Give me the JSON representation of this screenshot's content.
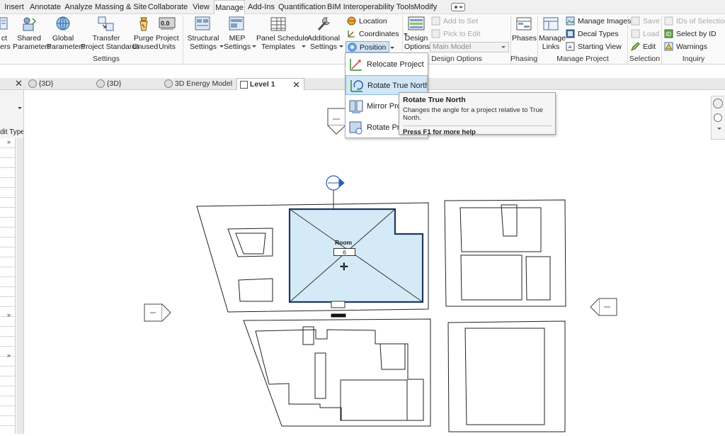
{
  "menu_tabs": [
    "Insert",
    "Annotate",
    "Analyze",
    "Massing & Site",
    "Collaborate",
    "View",
    "Manage",
    "Add-Ins",
    "Quantification",
    "BIM Interoperability Tools",
    "Modify"
  ],
  "active_menu_tab": "Manage",
  "ribbon": {
    "settings": {
      "cut_label_1": "ct",
      "cut_label_2": "ters",
      "shared_parameters_1": "Shared",
      "shared_parameters_2": "Parameters",
      "global_parameters_1": "Global",
      "global_parameters_2": "Parameters",
      "transfer_1": "Transfer",
      "transfer_2": "Project Standards",
      "purge_1": "Purge",
      "purge_2": "Unused",
      "project_units_1": "Project",
      "project_units_2": "Units",
      "units_icon_text": "0.0",
      "structural_1": "Structural",
      "structural_2": "Settings",
      "mep_1": "MEP",
      "mep_2": "Settings",
      "panel_schedule_1": "Panel Schedule",
      "panel_schedule_2": "Templates",
      "additional_1": "Additional",
      "additional_2": "Settings",
      "panel_label": "Settings"
    },
    "location": {
      "location": "Location",
      "coordinates": "Coordinates",
      "position": "Position"
    },
    "design_options": {
      "add_to_set": "Add to Set",
      "pick_to_edit": "Pick to Edit",
      "main_model": "Main Model",
      "design_options_1": "Design",
      "design_options_2": "Options",
      "panel_label": "Design Options"
    },
    "phasing": {
      "phases": "Phases",
      "panel_label": "Phasing"
    },
    "manage_project": {
      "manage_links_1": "Manage",
      "manage_links_2": "Links",
      "manage_images": "Manage  Images",
      "decal_types": "Decal  Types",
      "starting_view": "Starting  View",
      "panel_label": "Manage Project"
    },
    "selection": {
      "save": "Save",
      "load": "Load",
      "edit": "Edit",
      "panel_label": "Selection"
    },
    "inquiry": {
      "ids_of_selection": "IDs of  Selection",
      "select_by_id": "Select  by ID",
      "warnings": "Warnings",
      "panel_label": "Inquiry"
    }
  },
  "position_menu": {
    "items": [
      "Relocate Project",
      "Rotate True North",
      "Mirror Project",
      "Rotate Project"
    ],
    "highlighted": "Rotate True North"
  },
  "tooltip": {
    "title": "Rotate True North",
    "description": "Changes the angle for a project relative to True North.",
    "help": "Press F1 for more help"
  },
  "view_tabs": [
    {
      "label": "{3D}",
      "active": false
    },
    {
      "label": "{3D}",
      "active": false
    },
    {
      "label": "3D Energy Model",
      "active": false
    },
    {
      "label": "Level 1",
      "active": true
    }
  ],
  "left_panel": {
    "edit_type_fragment": "dit Type"
  },
  "canvas": {
    "room_name": "Room",
    "room_number": "6"
  },
  "colors": {
    "room_fill": "#d4eaf7",
    "highlight": "#d2e6f7",
    "elevation_blue": "#2a5fb0"
  }
}
